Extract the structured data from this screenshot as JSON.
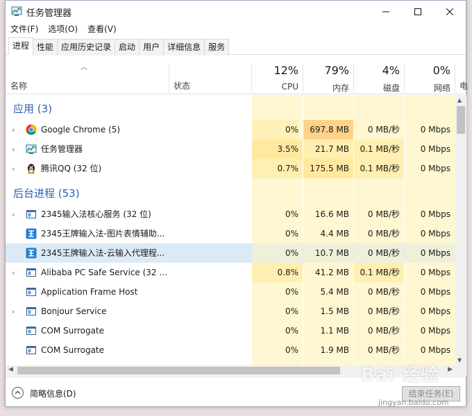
{
  "window": {
    "title": "任务管理器",
    "controls": {
      "minimize": "minimize-icon",
      "maximize": "maximize-icon",
      "close": "close-icon"
    }
  },
  "menu": [
    "文件(F)",
    "选项(O)",
    "查看(V)"
  ],
  "tabs": [
    "进程",
    "性能",
    "应用历史记录",
    "启动",
    "用户",
    "详细信息",
    "服务"
  ],
  "header": {
    "name_label": "名称",
    "status_label": "状态",
    "cpu": {
      "pct": "12%",
      "label": "CPU"
    },
    "mem": {
      "pct": "79%",
      "label": "内存"
    },
    "disk": {
      "pct": "4%",
      "label": "磁盘"
    },
    "net": {
      "pct": "0%",
      "label": "网络"
    },
    "extra": "电"
  },
  "groups": {
    "apps": "应用 (3)",
    "background": "后台进程 (53)"
  },
  "apps": [
    {
      "name": "Google Chrome (5)",
      "icon": "chrome-icon",
      "cpu": "0%",
      "mem": "697.8 MB",
      "disk": "0 MB/秒",
      "net": "0 Mbps"
    },
    {
      "name": "任务管理器",
      "icon": "task-manager-icon",
      "cpu": "3.5%",
      "mem": "21.7 MB",
      "disk": "0.1 MB/秒",
      "net": "0 Mbps"
    },
    {
      "name": "腾讯QQ (32 位)",
      "icon": "qq-penguin-icon",
      "cpu": "0.7%",
      "mem": "175.5 MB",
      "disk": "0.1 MB/秒",
      "net": "0 Mbps"
    }
  ],
  "background": [
    {
      "name": "2345输入法核心服务 (32 位)",
      "icon": "window-app-icon",
      "expandable": true,
      "cpu": "0%",
      "mem": "16.6 MB",
      "disk": "0 MB/秒",
      "net": "0 Mbps"
    },
    {
      "name": "2345王牌输入法-图片表情辅助...",
      "icon": "ime-blue-icon",
      "expandable": false,
      "cpu": "0%",
      "mem": "4.4 MB",
      "disk": "0 MB/秒",
      "net": "0 Mbps"
    },
    {
      "name": "2345王牌输入法-云输入代理程...",
      "icon": "ime-blue-icon",
      "expandable": false,
      "cpu": "0%",
      "mem": "10.7 MB",
      "disk": "0 MB/秒",
      "net": "0 Mbps"
    },
    {
      "name": "Alibaba PC Safe Service (32 ...",
      "icon": "window-app-icon",
      "expandable": true,
      "cpu": "0.8%",
      "mem": "41.2 MB",
      "disk": "0.1 MB/秒",
      "net": "0 Mbps"
    },
    {
      "name": "Application Frame Host",
      "icon": "window-app-icon",
      "expandable": false,
      "cpu": "0%",
      "mem": "5.4 MB",
      "disk": "0 MB/秒",
      "net": "0 Mbps"
    },
    {
      "name": "Bonjour Service",
      "icon": "window-app-icon",
      "expandable": true,
      "cpu": "0%",
      "mem": "1.5 MB",
      "disk": "0 MB/秒",
      "net": "0 Mbps"
    },
    {
      "name": "COM Surrogate",
      "icon": "window-app-icon",
      "expandable": false,
      "cpu": "0%",
      "mem": "1.1 MB",
      "disk": "0 MB/秒",
      "net": "0 Mbps"
    },
    {
      "name": "COM Surrogate",
      "icon": "window-app-icon",
      "expandable": false,
      "cpu": "0%",
      "mem": "1.9 MB",
      "disk": "0 MB/秒",
      "net": "0 Mbps"
    }
  ],
  "footer": {
    "fewer_details": "简略信息(D)",
    "end_task": "结束任务(E)"
  },
  "watermark": {
    "brand": "Bai 经验",
    "url": "jingyan.baidu.com"
  },
  "colors": {
    "group_title": "#2f5fb0",
    "heat_light": "#fff4c4",
    "heat_mid": "#ffe9a0",
    "heat_high": "#ffd28a",
    "selected_row": "#dceaf6"
  }
}
